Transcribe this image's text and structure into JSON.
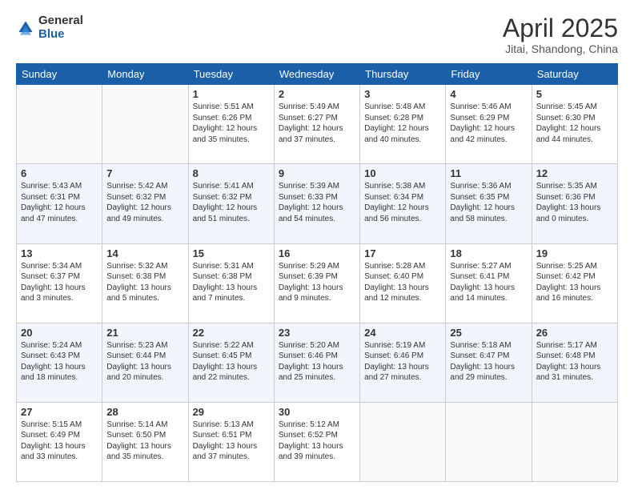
{
  "logo": {
    "general": "General",
    "blue": "Blue"
  },
  "title": "April 2025",
  "subtitle": "Jitai, Shandong, China",
  "days": [
    "Sunday",
    "Monday",
    "Tuesday",
    "Wednesday",
    "Thursday",
    "Friday",
    "Saturday"
  ],
  "weeks": [
    [
      {
        "day": null,
        "sunrise": null,
        "sunset": null,
        "daylight": null
      },
      {
        "day": null,
        "sunrise": null,
        "sunset": null,
        "daylight": null
      },
      {
        "day": "1",
        "sunrise": "Sunrise: 5:51 AM",
        "sunset": "Sunset: 6:26 PM",
        "daylight": "Daylight: 12 hours and 35 minutes."
      },
      {
        "day": "2",
        "sunrise": "Sunrise: 5:49 AM",
        "sunset": "Sunset: 6:27 PM",
        "daylight": "Daylight: 12 hours and 37 minutes."
      },
      {
        "day": "3",
        "sunrise": "Sunrise: 5:48 AM",
        "sunset": "Sunset: 6:28 PM",
        "daylight": "Daylight: 12 hours and 40 minutes."
      },
      {
        "day": "4",
        "sunrise": "Sunrise: 5:46 AM",
        "sunset": "Sunset: 6:29 PM",
        "daylight": "Daylight: 12 hours and 42 minutes."
      },
      {
        "day": "5",
        "sunrise": "Sunrise: 5:45 AM",
        "sunset": "Sunset: 6:30 PM",
        "daylight": "Daylight: 12 hours and 44 minutes."
      }
    ],
    [
      {
        "day": "6",
        "sunrise": "Sunrise: 5:43 AM",
        "sunset": "Sunset: 6:31 PM",
        "daylight": "Daylight: 12 hours and 47 minutes."
      },
      {
        "day": "7",
        "sunrise": "Sunrise: 5:42 AM",
        "sunset": "Sunset: 6:32 PM",
        "daylight": "Daylight: 12 hours and 49 minutes."
      },
      {
        "day": "8",
        "sunrise": "Sunrise: 5:41 AM",
        "sunset": "Sunset: 6:32 PM",
        "daylight": "Daylight: 12 hours and 51 minutes."
      },
      {
        "day": "9",
        "sunrise": "Sunrise: 5:39 AM",
        "sunset": "Sunset: 6:33 PM",
        "daylight": "Daylight: 12 hours and 54 minutes."
      },
      {
        "day": "10",
        "sunrise": "Sunrise: 5:38 AM",
        "sunset": "Sunset: 6:34 PM",
        "daylight": "Daylight: 12 hours and 56 minutes."
      },
      {
        "day": "11",
        "sunrise": "Sunrise: 5:36 AM",
        "sunset": "Sunset: 6:35 PM",
        "daylight": "Daylight: 12 hours and 58 minutes."
      },
      {
        "day": "12",
        "sunrise": "Sunrise: 5:35 AM",
        "sunset": "Sunset: 6:36 PM",
        "daylight": "Daylight: 13 hours and 0 minutes."
      }
    ],
    [
      {
        "day": "13",
        "sunrise": "Sunrise: 5:34 AM",
        "sunset": "Sunset: 6:37 PM",
        "daylight": "Daylight: 13 hours and 3 minutes."
      },
      {
        "day": "14",
        "sunrise": "Sunrise: 5:32 AM",
        "sunset": "Sunset: 6:38 PM",
        "daylight": "Daylight: 13 hours and 5 minutes."
      },
      {
        "day": "15",
        "sunrise": "Sunrise: 5:31 AM",
        "sunset": "Sunset: 6:38 PM",
        "daylight": "Daylight: 13 hours and 7 minutes."
      },
      {
        "day": "16",
        "sunrise": "Sunrise: 5:29 AM",
        "sunset": "Sunset: 6:39 PM",
        "daylight": "Daylight: 13 hours and 9 minutes."
      },
      {
        "day": "17",
        "sunrise": "Sunrise: 5:28 AM",
        "sunset": "Sunset: 6:40 PM",
        "daylight": "Daylight: 13 hours and 12 minutes."
      },
      {
        "day": "18",
        "sunrise": "Sunrise: 5:27 AM",
        "sunset": "Sunset: 6:41 PM",
        "daylight": "Daylight: 13 hours and 14 minutes."
      },
      {
        "day": "19",
        "sunrise": "Sunrise: 5:25 AM",
        "sunset": "Sunset: 6:42 PM",
        "daylight": "Daylight: 13 hours and 16 minutes."
      }
    ],
    [
      {
        "day": "20",
        "sunrise": "Sunrise: 5:24 AM",
        "sunset": "Sunset: 6:43 PM",
        "daylight": "Daylight: 13 hours and 18 minutes."
      },
      {
        "day": "21",
        "sunrise": "Sunrise: 5:23 AM",
        "sunset": "Sunset: 6:44 PM",
        "daylight": "Daylight: 13 hours and 20 minutes."
      },
      {
        "day": "22",
        "sunrise": "Sunrise: 5:22 AM",
        "sunset": "Sunset: 6:45 PM",
        "daylight": "Daylight: 13 hours and 22 minutes."
      },
      {
        "day": "23",
        "sunrise": "Sunrise: 5:20 AM",
        "sunset": "Sunset: 6:46 PM",
        "daylight": "Daylight: 13 hours and 25 minutes."
      },
      {
        "day": "24",
        "sunrise": "Sunrise: 5:19 AM",
        "sunset": "Sunset: 6:46 PM",
        "daylight": "Daylight: 13 hours and 27 minutes."
      },
      {
        "day": "25",
        "sunrise": "Sunrise: 5:18 AM",
        "sunset": "Sunset: 6:47 PM",
        "daylight": "Daylight: 13 hours and 29 minutes."
      },
      {
        "day": "26",
        "sunrise": "Sunrise: 5:17 AM",
        "sunset": "Sunset: 6:48 PM",
        "daylight": "Daylight: 13 hours and 31 minutes."
      }
    ],
    [
      {
        "day": "27",
        "sunrise": "Sunrise: 5:15 AM",
        "sunset": "Sunset: 6:49 PM",
        "daylight": "Daylight: 13 hours and 33 minutes."
      },
      {
        "day": "28",
        "sunrise": "Sunrise: 5:14 AM",
        "sunset": "Sunset: 6:50 PM",
        "daylight": "Daylight: 13 hours and 35 minutes."
      },
      {
        "day": "29",
        "sunrise": "Sunrise: 5:13 AM",
        "sunset": "Sunset: 6:51 PM",
        "daylight": "Daylight: 13 hours and 37 minutes."
      },
      {
        "day": "30",
        "sunrise": "Sunrise: 5:12 AM",
        "sunset": "Sunset: 6:52 PM",
        "daylight": "Daylight: 13 hours and 39 minutes."
      },
      {
        "day": null,
        "sunrise": null,
        "sunset": null,
        "daylight": null
      },
      {
        "day": null,
        "sunrise": null,
        "sunset": null,
        "daylight": null
      },
      {
        "day": null,
        "sunrise": null,
        "sunset": null,
        "daylight": null
      }
    ]
  ]
}
